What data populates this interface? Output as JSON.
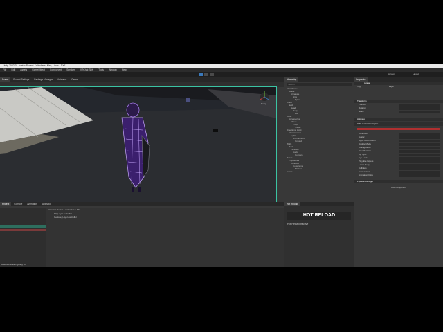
{
  "window": {
    "title": "Unity 2022.3 - Avatar Project - Windows, Mac, Linux - DX11"
  },
  "menu": [
    "File",
    "Edit",
    "Assets",
    "GameObject",
    "Component",
    "Services",
    "VRChat SDK",
    "Tools",
    "Window",
    "Help"
  ],
  "toolbar": {
    "layout_label": "Layout",
    "account_label": "Account"
  },
  "scene_tabs": [
    "Scene",
    "Project Settings",
    "Package Manager",
    "Animator",
    "Game"
  ],
  "scene": {
    "gizmo_label": "Persp"
  },
  "hierarchy": {
    "tab": "Hierarchy",
    "search_placeholder": "Search",
    "items": [
      "Main Scene",
      "Avatar",
      "Armature",
      "Hips",
      "Spine",
      "Chest",
      "Neck",
      "Head",
      "Body",
      "Hair",
      "Outfit",
      "Accessories",
      "Shoes",
      "Props",
      "Shield",
      "Directional Light",
      "Main Camera",
      "Lights",
      "Environment",
      "Ground",
      "Walls",
      "Roof",
      "Particles",
      "Audio",
      "Colliders",
      "Bones",
      "PhysBones",
      "Contacts",
      "Constraints",
      "Markers",
      "Extras"
    ]
  },
  "inspector": {
    "tab": "Inspector",
    "object_name": "Avatar",
    "tag_label": "Tag",
    "layer_label": "Layer",
    "sections": [
      "Transform",
      "Animator",
      "VRC Avatar Descriptor",
      "Pipeline Manager"
    ],
    "transform_rows": [
      {
        "label": "Position"
      },
      {
        "label": "Rotation"
      },
      {
        "label": "Scale"
      }
    ],
    "component_rows": [
      "Controller",
      "Avatar",
      "Apply Root Motion",
      "Update Mode",
      "Culling Mode",
      "View Position",
      "Lip Sync",
      "Eye Look",
      "Playable Layers",
      "Lower Body",
      "Colliders",
      "Expressions",
      "Animation Clips"
    ],
    "footer_label": "Add Component"
  },
  "bottom_tabs": [
    "Project",
    "Console",
    "Animation",
    "Animator"
  ],
  "hot_reload": {
    "tab": "Hot Reload",
    "logo": "HOT RELOAD",
    "status": "Hot Reload inactive"
  },
  "project": {
    "breadcrumb": "Assets > Avatar > Animation > FX",
    "files": [
      "FX_Layer.controller",
      "Gesture_Layer.controller"
    ],
    "status": "Auto Generate Lighting Off"
  },
  "colors": {
    "accent": "#3a79bb",
    "scene_outline": "#3bc3a3",
    "red_bar": "#b03030",
    "avatar_purple": "#7a3fd6"
  }
}
